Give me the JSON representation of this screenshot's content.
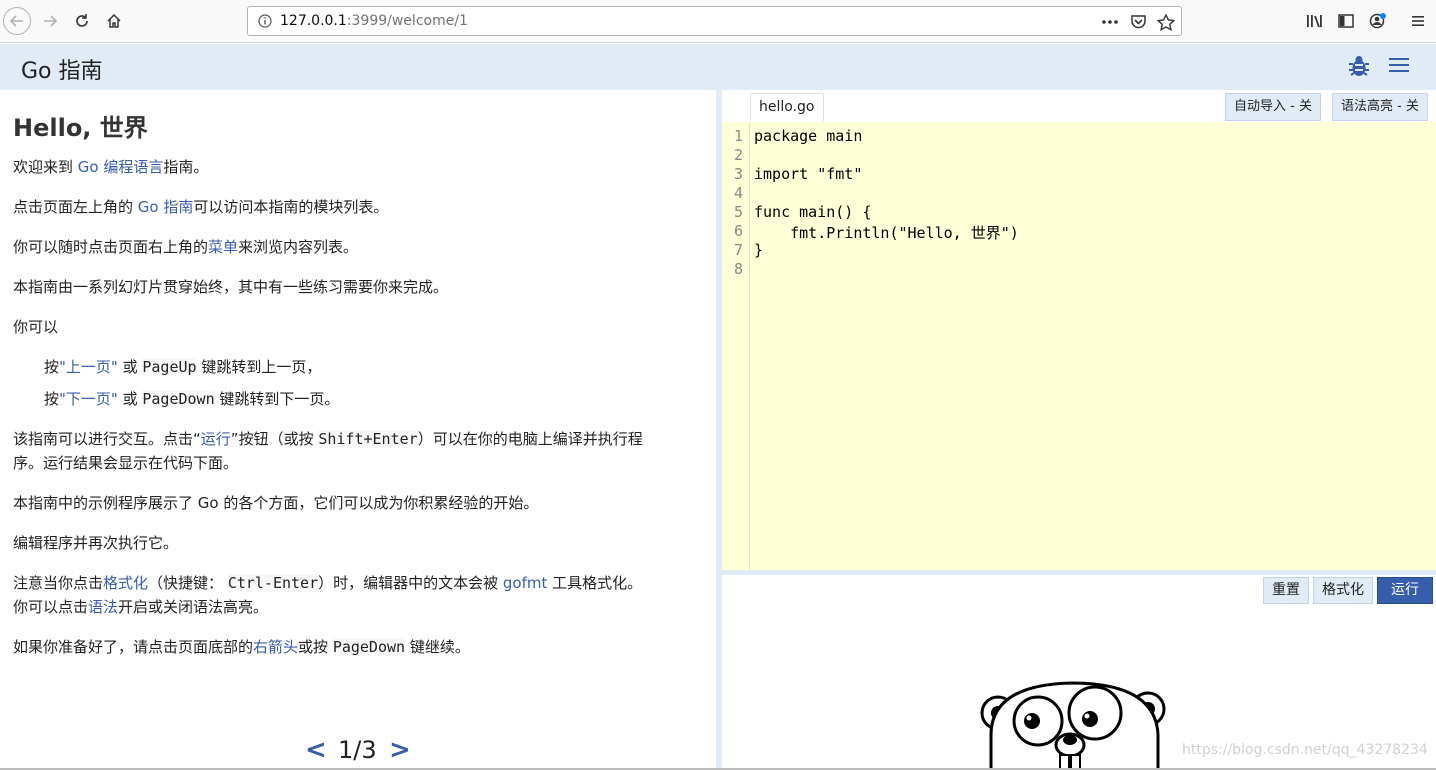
{
  "browser": {
    "url_host": "127.0.0.1",
    "url_rest": ":3999/welcome/1"
  },
  "header": {
    "brand": "Go 指南"
  },
  "lesson": {
    "title": "Hello, 世界",
    "p1_pre": "欢迎来到 ",
    "p1_link": "Go 编程语言",
    "p1_post": "指南。",
    "p2_pre": "点击页面左上角的 ",
    "p2_link": "Go 指南",
    "p2_post": "可以访问本指南的模块列表。",
    "p3_pre": "你可以随时点击页面右上角的",
    "p3_link": "菜单",
    "p3_post": "来浏览内容列表。",
    "p4": "本指南由一系列幻灯片贯穿始终，其中有一些练习需要你来完成。",
    "p5": "你可以",
    "li1_pre": "按",
    "li1_link": "\"上一页\"",
    "li1_mid": " 或 ",
    "li1_code": "PageUp",
    "li1_post": " 键跳转到上一页，",
    "li2_pre": "按",
    "li2_link": "\"下一页\"",
    "li2_mid": " 或 ",
    "li2_code": "PageDown",
    "li2_post": " 键跳转到下一页。",
    "p6_pre": "该指南可以进行交互。点击“",
    "p6_link": "运行",
    "p6_mid": "”按钮（或按 ",
    "p6_code": "Shift+Enter",
    "p6_post": "）可以在你的电脑上编译并执行程",
    "p6_line2": "序。运行结果会显示在代码下面。",
    "p7": "本指南中的示例程序展示了 Go 的各个方面，它们可以成为你积累经验的开始。",
    "p8": "编辑程序并再次执行它。",
    "p9_pre": "注意当你点击",
    "p9_link": "格式化",
    "p9_mid": "（快捷键： ",
    "p9_code": "Ctrl-Enter",
    "p9_mid2": "）时，编辑器中的文本会被 ",
    "p9_link2": "gofmt",
    "p9_post": " 工具格式化。",
    "p9_line2_pre": "你可以点击",
    "p9_line2_link": "语法",
    "p9_line2_post": "开启或关闭语法高亮。",
    "p10_pre": "如果你准备好了，请点击页面底部的",
    "p10_link": "右箭头",
    "p10_mid": "或按 ",
    "p10_code": "PageDown",
    "p10_post": " 键继续。"
  },
  "pager": {
    "prev": "<",
    "page": "1/3",
    "next": ">"
  },
  "editor": {
    "file_tab": "hello.go",
    "autoimport": "自动导入 - 关",
    "syntax": "语法高亮 - 关",
    "lines": [
      "1",
      "2",
      "3",
      "4",
      "5",
      "6",
      "7",
      "8"
    ],
    "code": [
      "package main",
      "",
      "import \"fmt\"",
      "",
      "func main() {",
      "    fmt.Println(\"Hello, 世界\")",
      "}",
      ""
    ]
  },
  "controls": {
    "reset": "重置",
    "format": "格式化",
    "run": "运行"
  },
  "watermark": "https://blog.csdn.net/qq_43278234"
}
